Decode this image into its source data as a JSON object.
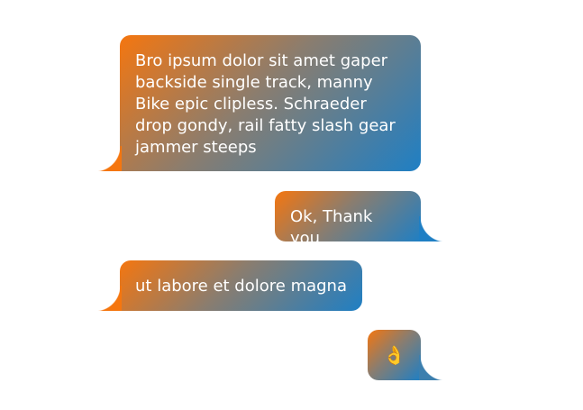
{
  "messages": [
    {
      "side": "left",
      "text": "Bro ipsum dolor sit amet gaper backside single track, manny Bike epic clipless. Schraeder drop gondy, rail fatty slash gear jammer steeps"
    },
    {
      "side": "right",
      "text": "Ok, Thank you"
    },
    {
      "side": "left",
      "text": "ut labore et dolore magna"
    },
    {
      "side": "right",
      "text": "👌"
    }
  ],
  "colors": {
    "gradient_start": "#f5760f",
    "gradient_end": "#1f7fc4",
    "text": "#ffffff"
  }
}
